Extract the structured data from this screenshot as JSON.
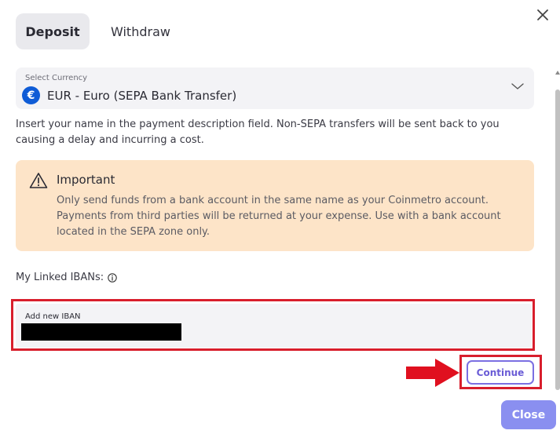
{
  "tabs": {
    "deposit": "Deposit",
    "withdraw": "Withdraw"
  },
  "currency": {
    "label": "Select Currency",
    "icon_symbol": "€",
    "value": "EUR - Euro (SEPA Bank Transfer)",
    "icon_color": "#0f5cd6"
  },
  "instruction": "Insert your name in the payment description field. Non-SEPA transfers will be sent back to you causing a delay and incurring a cost.",
  "warning": {
    "title": "Important",
    "text": "Only send funds from a bank account in the same name as your Coinmetro account. Payments from third parties will be returned at your expense. Use with a bank account located in the SEPA zone only.",
    "background": "#fde4c8"
  },
  "linked_ibans": {
    "label": "My Linked IBANs:"
  },
  "iban": {
    "label": "Add new IBAN"
  },
  "buttons": {
    "continue": "Continue",
    "close": "Close"
  },
  "colors": {
    "accent": "#7b6fe2",
    "highlight": "#d81e2c",
    "close_button": "#8a8ff0"
  }
}
